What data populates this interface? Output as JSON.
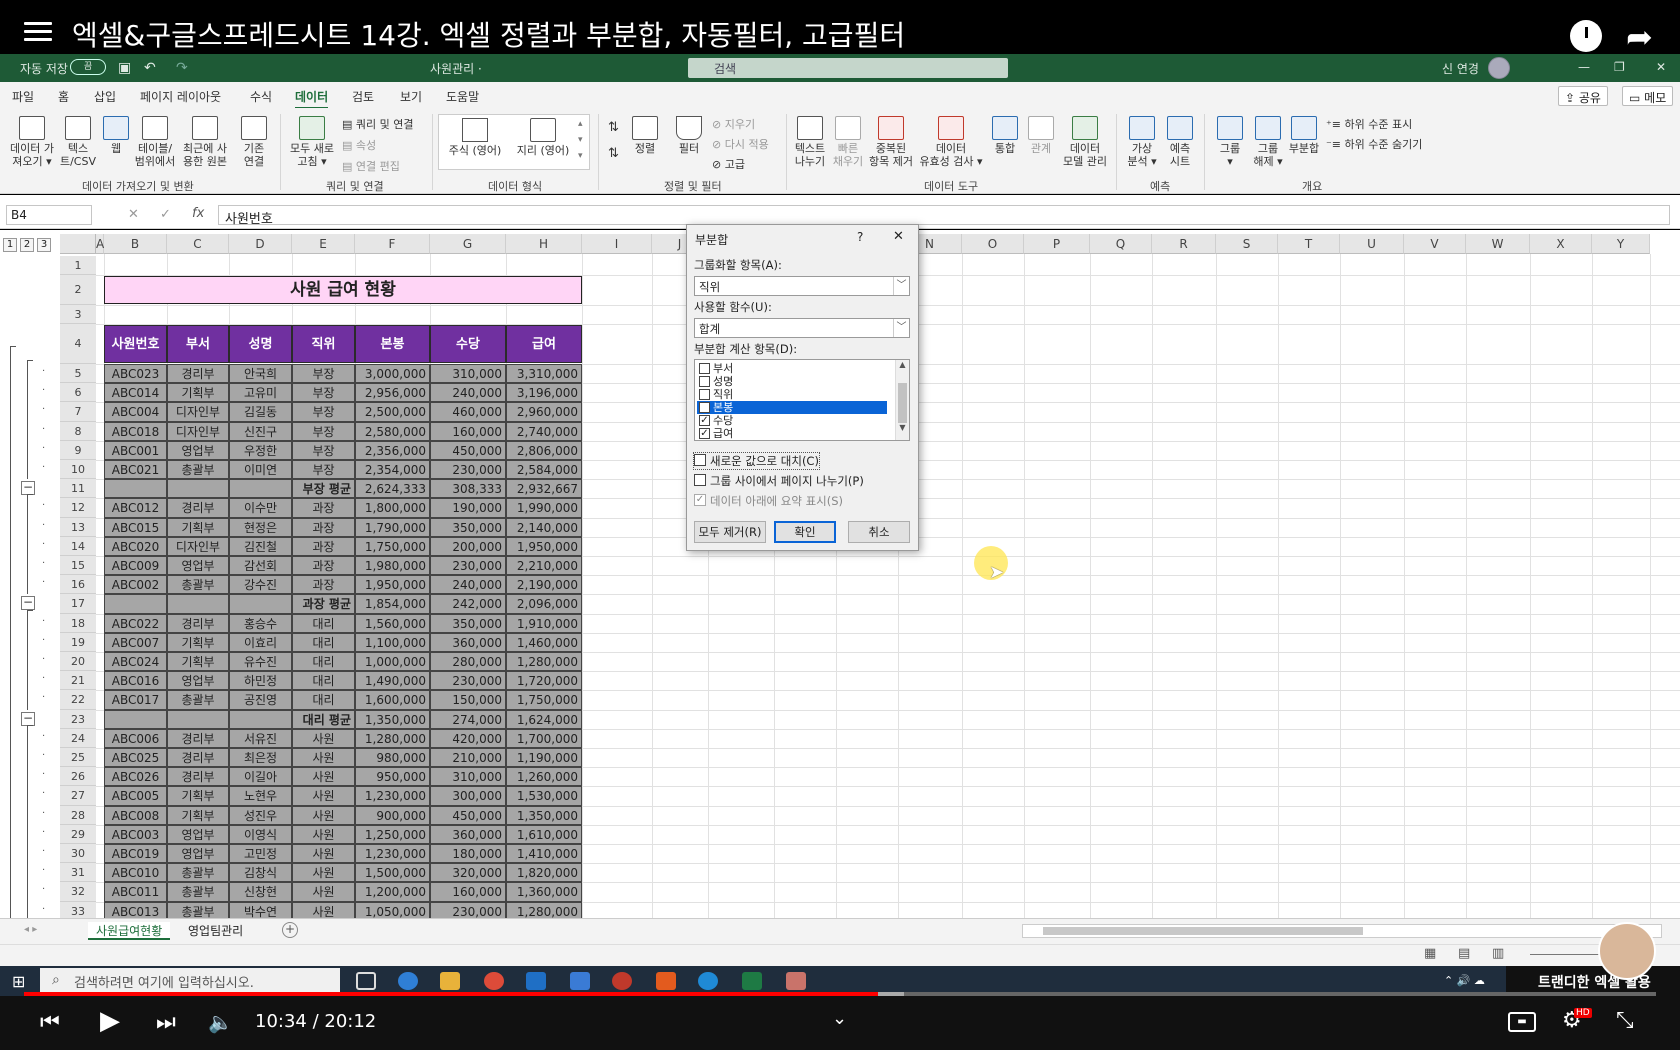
{
  "video": {
    "title": "엑셀&구글스프레드시트 14강. 엑셀 정렬과 부분합, 자동필터, 고급필터",
    "time": "10:34 / 20:12",
    "progress_fraction": 0.523,
    "promo": "트랜디한 엑셀 활용",
    "hd_badge": "HD"
  },
  "excel": {
    "autosave": "자동 저장",
    "toggle": "끔",
    "filename": "사원관리 ·",
    "search": "검색",
    "user": "신 연경",
    "share": "공유",
    "memo": "메모"
  },
  "tabs": [
    "파일",
    "홈",
    "삽입",
    "페이지 레이아웃",
    "수식",
    "데이터",
    "검토",
    "보기",
    "도움말"
  ],
  "active_tab": "데이터",
  "ribbon": {
    "get_data": "데이터 가\n져오기 ▾",
    "text_csv": "텍스\n트/CSV",
    "web": "웹",
    "from_table": "테이블/\n범위에서",
    "recent": "최근에 사\n용한 원본",
    "existing": "기존\n연결",
    "refresh_all": "모두 새로\n고침 ▾",
    "queries": "쿼리 및 연결",
    "properties": "속성",
    "edit_links": "연결 편집",
    "stocks": "주식 (영어)",
    "geo": "지리 (영어)",
    "sort": "정렬",
    "filter": "필터",
    "clear": "지우기",
    "reapply": "다시 적용",
    "advanced": "고급",
    "text_to_cols": "텍스트\n나누기",
    "flash_fill": "빠른\n채우기",
    "remove_dup": "중복된\n항목 제거",
    "validation": "데이터\n유효성 검사 ▾",
    "consolidate": "통합",
    "relations": "관계",
    "data_model": "데이터\n모델 관리",
    "whatif": "가상\n분석 ▾",
    "forecast": "예측\n시트",
    "group": "그룹\n▾",
    "ungroup": "그룹\n해제 ▾",
    "subtotal": "부분합",
    "show_detail": "하위 수준 표시",
    "hide_detail": "하위 수준 숨기기",
    "groups": [
      "데이터 가져오기 및 변환",
      "쿼리 및 연결",
      "데이터 형식",
      "정렬 및 필터",
      "데이터 도구",
      "예측",
      "개요"
    ]
  },
  "formula": {
    "namebox": "B4",
    "fx": "fx",
    "content": "사원번호"
  },
  "outline_levels": [
    "1",
    "2",
    "3"
  ],
  "columns": [
    "A",
    "B",
    "C",
    "D",
    "E",
    "F",
    "G",
    "H",
    "I",
    "J",
    "K",
    "L",
    "M",
    "N",
    "O",
    "P",
    "Q",
    "R",
    "S",
    "T",
    "U",
    "V",
    "W",
    "X",
    "Y"
  ],
  "sheet": {
    "title": "사원 급여 현황",
    "headers": [
      "사원번호",
      "부서",
      "성명",
      "직위",
      "본봉",
      "수당",
      "급여"
    ],
    "rows": [
      {
        "r": "5",
        "c": [
          "ABC023",
          "경리부",
          "안국희",
          "부장",
          "3,000,000",
          "310,000",
          "3,310,000"
        ]
      },
      {
        "r": "6",
        "c": [
          "ABC014",
          "기획부",
          "고유미",
          "부장",
          "2,956,000",
          "240,000",
          "3,196,000"
        ]
      },
      {
        "r": "7",
        "c": [
          "ABC004",
          "디자인부",
          "김길동",
          "부장",
          "2,500,000",
          "460,000",
          "2,960,000"
        ]
      },
      {
        "r": "8",
        "c": [
          "ABC018",
          "디자인부",
          "신진구",
          "부장",
          "2,580,000",
          "160,000",
          "2,740,000"
        ]
      },
      {
        "r": "9",
        "c": [
          "ABC001",
          "영업부",
          "우정한",
          "부장",
          "2,356,000",
          "450,000",
          "2,806,000"
        ]
      },
      {
        "r": "10",
        "c": [
          "ABC021",
          "총괄부",
          "이미연",
          "부장",
          "2,354,000",
          "230,000",
          "2,584,000"
        ]
      },
      {
        "r": "11",
        "sub": true,
        "c": [
          "",
          "",
          "",
          "부장 평균",
          "2,624,333",
          "308,333",
          "2,932,667"
        ]
      },
      {
        "r": "12",
        "c": [
          "ABC012",
          "경리부",
          "이수만",
          "과장",
          "1,800,000",
          "190,000",
          "1,990,000"
        ]
      },
      {
        "r": "13",
        "c": [
          "ABC015",
          "기획부",
          "현정은",
          "과장",
          "1,790,000",
          "350,000",
          "2,140,000"
        ]
      },
      {
        "r": "14",
        "c": [
          "ABC020",
          "디자인부",
          "김진철",
          "과장",
          "1,750,000",
          "200,000",
          "1,950,000"
        ]
      },
      {
        "r": "15",
        "c": [
          "ABC009",
          "영업부",
          "감선회",
          "과장",
          "1,980,000",
          "230,000",
          "2,210,000"
        ]
      },
      {
        "r": "16",
        "c": [
          "ABC002",
          "총괄부",
          "강수진",
          "과장",
          "1,950,000",
          "240,000",
          "2,190,000"
        ]
      },
      {
        "r": "17",
        "sub": true,
        "c": [
          "",
          "",
          "",
          "과장 평균",
          "1,854,000",
          "242,000",
          "2,096,000"
        ]
      },
      {
        "r": "18",
        "c": [
          "ABC022",
          "경리부",
          "홍승수",
          "대리",
          "1,560,000",
          "350,000",
          "1,910,000"
        ]
      },
      {
        "r": "19",
        "c": [
          "ABC007",
          "기획부",
          "이효리",
          "대리",
          "1,100,000",
          "360,000",
          "1,460,000"
        ]
      },
      {
        "r": "20",
        "c": [
          "ABC024",
          "기획부",
          "유수진",
          "대리",
          "1,000,000",
          "280,000",
          "1,280,000"
        ]
      },
      {
        "r": "21",
        "c": [
          "ABC016",
          "영업부",
          "하민정",
          "대리",
          "1,490,000",
          "230,000",
          "1,720,000"
        ]
      },
      {
        "r": "22",
        "c": [
          "ABC017",
          "총괄부",
          "공진영",
          "대리",
          "1,600,000",
          "150,000",
          "1,750,000"
        ]
      },
      {
        "r": "23",
        "sub": true,
        "c": [
          "",
          "",
          "",
          "대리 평균",
          "1,350,000",
          "274,000",
          "1,624,000"
        ]
      },
      {
        "r": "24",
        "c": [
          "ABC006",
          "경리부",
          "서유진",
          "사원",
          "1,280,000",
          "420,000",
          "1,700,000"
        ]
      },
      {
        "r": "25",
        "c": [
          "ABC025",
          "경리부",
          "최은정",
          "사원",
          "980,000",
          "210,000",
          "1,190,000"
        ]
      },
      {
        "r": "26",
        "c": [
          "ABC026",
          "경리부",
          "이길아",
          "사원",
          "950,000",
          "310,000",
          "1,260,000"
        ]
      },
      {
        "r": "27",
        "c": [
          "ABC005",
          "기획부",
          "노현우",
          "사원",
          "1,230,000",
          "300,000",
          "1,530,000"
        ]
      },
      {
        "r": "28",
        "c": [
          "ABC008",
          "기획부",
          "성진우",
          "사원",
          "900,000",
          "450,000",
          "1,350,000"
        ]
      },
      {
        "r": "29",
        "c": [
          "ABC003",
          "영업부",
          "이영식",
          "사원",
          "1,250,000",
          "360,000",
          "1,610,000"
        ]
      },
      {
        "r": "30",
        "c": [
          "ABC019",
          "영업부",
          "고민정",
          "사원",
          "1,230,000",
          "180,000",
          "1,410,000"
        ]
      },
      {
        "r": "31",
        "c": [
          "ABC010",
          "총괄부",
          "김창식",
          "사원",
          "1,500,000",
          "320,000",
          "1,820,000"
        ]
      },
      {
        "r": "32",
        "c": [
          "ABC011",
          "총괄부",
          "신창현",
          "사원",
          "1,200,000",
          "160,000",
          "1,360,000"
        ]
      },
      {
        "r": "33",
        "c": [
          "ABC013",
          "총괄부",
          "박수연",
          "사원",
          "1,050,000",
          "230,000",
          "1,280,000"
        ]
      }
    ]
  },
  "dialog": {
    "title": "부분합",
    "help": "?",
    "close": "✕",
    "group_label": "그룹화할 항목(A):",
    "group_value": "직위",
    "func_label": "사용할 함수(U):",
    "func_value": "합계",
    "calc_label": "부분합 계산 항목(D):",
    "items": [
      {
        "label": "부서",
        "checked": false,
        "selected": false
      },
      {
        "label": "성명",
        "checked": false,
        "selected": false
      },
      {
        "label": "직위",
        "checked": false,
        "selected": false
      },
      {
        "label": "본봉",
        "checked": true,
        "selected": true
      },
      {
        "label": "수당",
        "checked": true,
        "selected": false
      },
      {
        "label": "급여",
        "checked": true,
        "selected": false
      }
    ],
    "replace": "새로운 값으로 대치(C)",
    "pagebreak": "그룹 사이에서 페이지 나누기(P)",
    "summary": "데이터 아래에 요약 표시(S)",
    "remove_all": "모두 제거(R)",
    "ok": "확인",
    "cancel": "취소"
  },
  "sheet_tabs": [
    "사원급여현황",
    "영업팀관리"
  ],
  "taskbar": {
    "search": "검색하려면 여기에 입력하십시오."
  },
  "colors": {
    "purple": "#7030a0",
    "pinkTitle": "#ffd5f6",
    "excelGreen": "#1e5a36",
    "gray": "#a6a6a6"
  }
}
